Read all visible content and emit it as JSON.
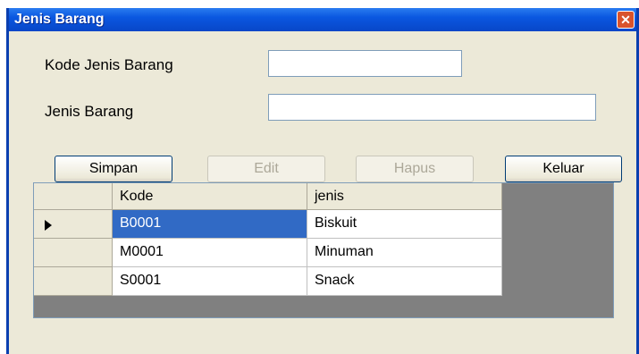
{
  "window": {
    "title": "Jenis Barang",
    "close_icon": "close-icon"
  },
  "form": {
    "kode_label": "Kode Jenis Barang",
    "kode_value": "",
    "jenis_label": "Jenis Barang",
    "jenis_value": ""
  },
  "buttons": {
    "simpan": "Simpan",
    "edit": "Edit",
    "hapus": "Hapus",
    "keluar": "Keluar"
  },
  "grid": {
    "columns": [
      "Kode",
      "jenis"
    ],
    "rows": [
      {
        "kode": "B0001",
        "jenis": "Biskuit",
        "selected": true
      },
      {
        "kode": "M0001",
        "jenis": "Minuman",
        "selected": false
      },
      {
        "kode": "S0001",
        "jenis": "Snack",
        "selected": false
      }
    ]
  },
  "colors": {
    "titlebar": "#0a57e0",
    "selection": "#316ac5",
    "window_bg": "#ece9d8"
  }
}
